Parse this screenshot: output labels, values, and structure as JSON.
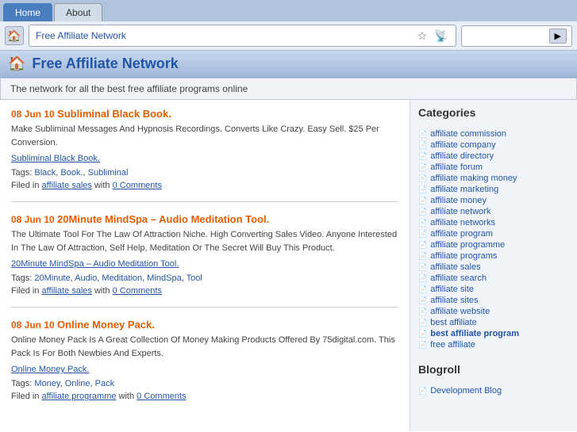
{
  "browser": {
    "tabs": [
      {
        "label": "Home",
        "active": true
      },
      {
        "label": "About",
        "active": false
      }
    ],
    "url": "Free Affiliate Network",
    "search_placeholder": ""
  },
  "site": {
    "title": "Free Affiliate Network",
    "tagline": "The network for all the best free affiliate programs online"
  },
  "posts": [
    {
      "date": "08 Jun 10",
      "title": "Subliminal Black Book.",
      "title_link": "#",
      "description": "Make Subliminal Messages And Hypnosis Recordings. Converts Like Crazy. Easy Sell. $25 Per Conversion.",
      "post_link_text": "Subliminal Black Book.",
      "post_link_href": "#",
      "tags_label": "Tags:",
      "tags": [
        {
          "label": "Black",
          "href": "#"
        },
        {
          "label": "Book.",
          "href": "#"
        },
        {
          "label": "Subliminal",
          "href": "#"
        }
      ],
      "filed_label": "Filed in",
      "filed_category": "affiliate sales",
      "filed_href": "#",
      "filed_with": "with",
      "comments": "0 Comments",
      "comments_href": "#"
    },
    {
      "date": "08 Jun 10",
      "title": "20Minute MindSpa – Audio Meditation Tool.",
      "title_link": "#",
      "description": "The Ultimate Tool For The Law Of Attraction Niche. High Converting Sales Video. Anyone Interested In The Law Of Attraction, Self Help, Meditation Or The Secret Will Buy This Product.",
      "post_link_text": "20Minute MindSpa – Audio Meditation Tool.",
      "post_link_href": "#",
      "tags_label": "Tags:",
      "tags": [
        {
          "label": "20Minute",
          "href": "#"
        },
        {
          "label": "Audio",
          "href": "#"
        },
        {
          "label": "Meditation",
          "href": "#"
        },
        {
          "label": "MindSpa",
          "href": "#"
        },
        {
          "label": "Tool",
          "href": "#"
        }
      ],
      "filed_label": "Filed in",
      "filed_category": "affiliate sales",
      "filed_href": "#",
      "filed_with": "with",
      "comments": "0 Comments",
      "comments_href": "#"
    },
    {
      "date": "08 Jun 10",
      "title": "Online Money Pack.",
      "title_link": "#",
      "description": "Online Money Pack Is A Great Collection Of Money Making Products Offered By 75digital.com. This Pack Is For Both Newbies And Experts.",
      "post_link_text": "Online Money Pack.",
      "post_link_href": "#",
      "tags_label": "Tags:",
      "tags": [
        {
          "label": "Money",
          "href": "#"
        },
        {
          "label": "Online",
          "href": "#"
        },
        {
          "label": "Pack",
          "href": "#"
        }
      ],
      "filed_label": "Filed in",
      "filed_category": "affiliate programme",
      "filed_href": "#",
      "filed_with": "with",
      "comments": "0 Comments",
      "comments_href": "#"
    }
  ],
  "sidebar": {
    "categories_title": "Categories",
    "categories": [
      {
        "label": "affiliate commission"
      },
      {
        "label": "affiliate company"
      },
      {
        "label": "affiliate directory"
      },
      {
        "label": "affiliate forum"
      },
      {
        "label": "affiliate making money"
      },
      {
        "label": "affiliate marketing"
      },
      {
        "label": "affiliate money"
      },
      {
        "label": "affiliate network"
      },
      {
        "label": "affiliate networks"
      },
      {
        "label": "affiliate program"
      },
      {
        "label": "affiliate programme"
      },
      {
        "label": "affiliate programs"
      },
      {
        "label": "affiliate sales"
      },
      {
        "label": "affiliate search"
      },
      {
        "label": "affiliate site"
      },
      {
        "label": "affiliate sites"
      },
      {
        "label": "affiliate website"
      },
      {
        "label": "best affiliate"
      },
      {
        "label": "best affiliate program"
      },
      {
        "label": "free affiliate"
      }
    ],
    "blogroll_title": "Blogroll",
    "blogroll": [
      {
        "label": "Development Blog"
      }
    ]
  }
}
